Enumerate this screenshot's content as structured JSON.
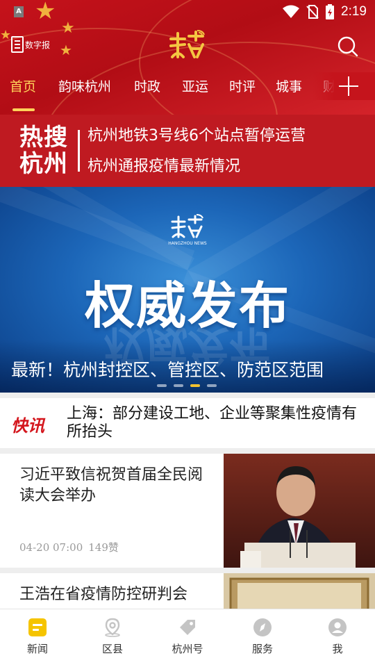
{
  "status_bar": {
    "app_badge": "A",
    "time": "2:19",
    "icons": [
      "wifi-icon",
      "no-sim-icon",
      "battery-icon"
    ]
  },
  "header": {
    "digital_paper_label": "数字报",
    "logo": "hangzhou-logo",
    "accent_color": "#ffd35a",
    "bg_color": "#c5121b"
  },
  "tabs": [
    {
      "label": "首页",
      "active": true
    },
    {
      "label": "韵味杭州",
      "active": false
    },
    {
      "label": "时政",
      "active": false
    },
    {
      "label": "亚运",
      "active": false
    },
    {
      "label": "时评",
      "active": false
    },
    {
      "label": "城事",
      "active": false
    },
    {
      "label": "财",
      "active": false
    }
  ],
  "hot_search": {
    "label_line1": "热搜",
    "label_line2": "杭州",
    "items": [
      "杭州地铁3号线6个站点暂停运营",
      "杭州通报疫情最新情况"
    ]
  },
  "banner": {
    "logo_text": "HANGZHOU NEWS",
    "headline": "权威发布",
    "caption": "最新！杭州封控区、管控区、防范区范围",
    "pages": 4,
    "active_page": 3
  },
  "flash_news": {
    "label": "快讯",
    "text": "上海：部分建设工地、企业等聚集性疫情有所抬头"
  },
  "articles": [
    {
      "title": "习近平致信祝贺首届全民阅读大会举办",
      "time": "04-20 07:00",
      "likes": "149赞"
    },
    {
      "title": "王浩在省疫情防控研判会",
      "time": "",
      "likes": ""
    }
  ],
  "bottom_nav": [
    {
      "label": "新闻",
      "icon": "news-icon",
      "active": true
    },
    {
      "label": "区县",
      "icon": "location-pin-icon",
      "active": false
    },
    {
      "label": "杭州号",
      "icon": "tag-icon",
      "active": false
    },
    {
      "label": "服务",
      "icon": "compass-icon",
      "active": false
    },
    {
      "label": "我",
      "icon": "user-icon",
      "active": false
    }
  ]
}
